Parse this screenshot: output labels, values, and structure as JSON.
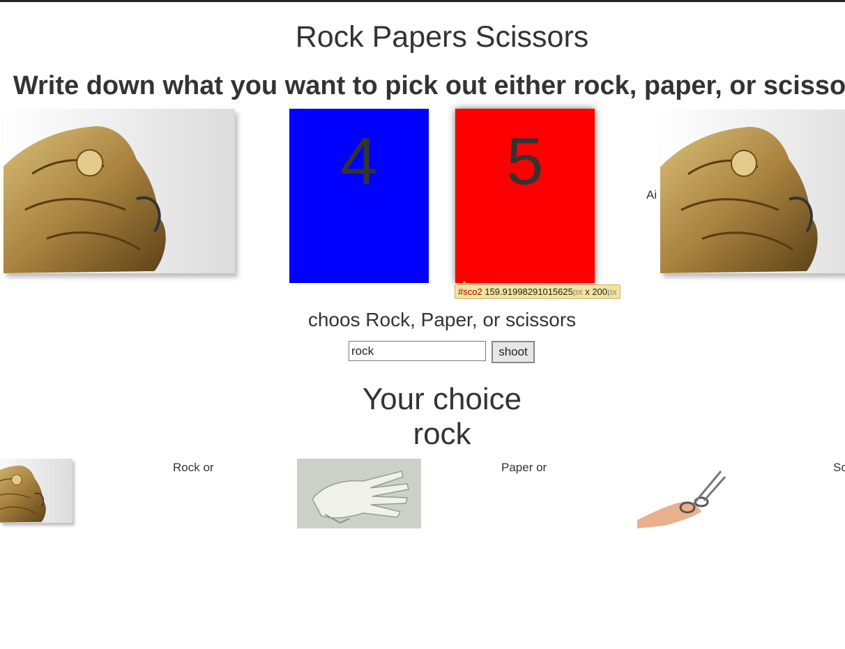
{
  "page": {
    "title": "Rock Papers Scissors",
    "subtitle": "Write down what you want to pick out either rock, paper, or scissors"
  },
  "scoreboard": {
    "player_score": "4",
    "ai_score": "5",
    "player_color": "#0000ff",
    "ai_color": "#ff0000",
    "ai_label": "Ai"
  },
  "devtools_tooltip": {
    "selector": "#sco2",
    "width_value": "159.91998291015625",
    "width_unit": "px",
    "separator": " x ",
    "height_value": "200",
    "height_unit": "px"
  },
  "controls": {
    "prompt": "choos Rock, Paper, or scissors",
    "input_value": "rock",
    "shoot_label": "shoot"
  },
  "result": {
    "heading": "Your choice",
    "value": "rock"
  },
  "options": [
    {
      "label": "Rock or",
      "icon": "rock-image"
    },
    {
      "label": "Paper or",
      "icon": "paper-hand-image"
    },
    {
      "label": "Sc",
      "icon": "scissors-image"
    }
  ]
}
